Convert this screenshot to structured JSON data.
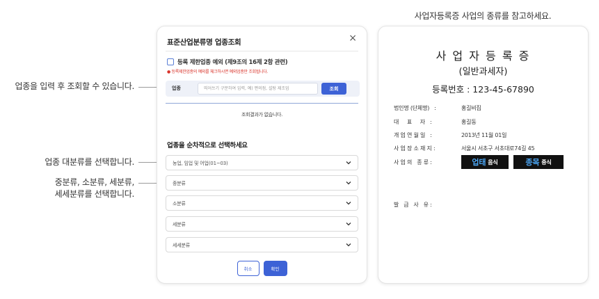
{
  "annotations": {
    "search_hint": "업종을 입력 후 조회할 수 있습니다.",
    "major_hint": "업종 대분류를 선택합니다.",
    "sub_hint_line1": "중분류, 소분류, 세분류,",
    "sub_hint_line2": "세세분류를 선택합니다."
  },
  "modal": {
    "title": "표준산업분류명 업종조회",
    "close_label": "×",
    "restricted_checkbox_label": "등록 제한업종 예외 (제9조의 16제 2항 관련)",
    "restricted_note": "● 등록제한업종의 예외를 체크하시면 예외업종만 조회됩니다.",
    "search": {
      "label": "업종",
      "placeholder": "띄어쓰기 구분하여 입력, 예) 편의점, 설탕 제조업",
      "value": "",
      "button": "조회"
    },
    "no_result": "조회결과가 없습니다.",
    "select_section_title": "업종을 순차적으로 선택하세요",
    "selects": [
      {
        "label": "농업, 임업 및 어업(01~03)"
      },
      {
        "label": "중분류"
      },
      {
        "label": "소분류"
      },
      {
        "label": "세분류"
      },
      {
        "label": "세세분류"
      }
    ],
    "cancel_button": "취소",
    "confirm_button": "확인"
  },
  "certificate": {
    "caption": "사업자등록증 사업의 종류를 참고하세요.",
    "title": "사 업 자 등 록 증",
    "subtitle": "(일반과세자)",
    "reg_number": "등록번호 : 123-45-67890",
    "rows": [
      {
        "label": "법인명 (단체명)   :",
        "value": "홍길비집"
      },
      {
        "label": "대     표     자   :",
        "value": "홍길동"
      },
      {
        "label": "개 업 연 월 일   :",
        "value": "2013년 11월 01일"
      },
      {
        "label": "사 업 장 소 재 지 :",
        "value": "서울시 서초구 서초대로74길 45"
      },
      {
        "label": "사 업 의   종 류 :",
        "value": ""
      },
      {
        "label": "발   급   사   유 :",
        "value": ""
      }
    ],
    "tags": [
      {
        "big": "업태",
        "small": "음식"
      },
      {
        "big": "종목",
        "small": "중식"
      }
    ]
  },
  "colors": {
    "accent": "#3d62d6",
    "warning": "#d9342b",
    "tag_background": "#111111",
    "tag_highlight": "#4aa3f0"
  }
}
